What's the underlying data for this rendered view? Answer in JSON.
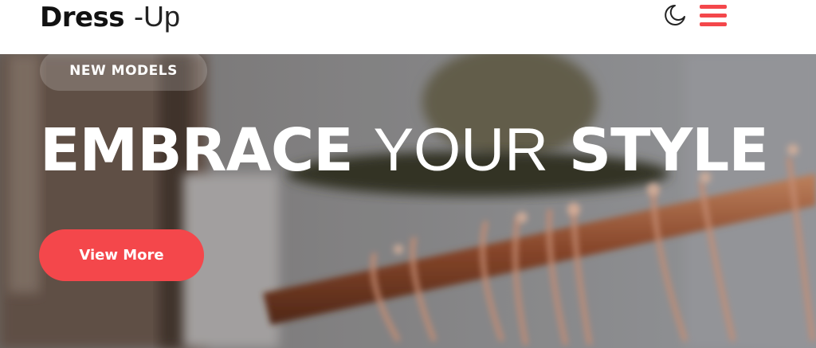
{
  "brand": {
    "bold": "Dress",
    "light": "-Up"
  },
  "header": {
    "theme_toggle_icon": "moon-icon",
    "menu_icon": "hamburger-menu-icon",
    "accent_color": "#f4474b"
  },
  "hero": {
    "badge": "NEW MODELS",
    "headline": {
      "word1": "EMBRACE",
      "word2": "YOUR",
      "word3": "STYLE"
    },
    "cta_label": "View More",
    "background_image": "clothing-rack-with-hangers-and-hat"
  }
}
